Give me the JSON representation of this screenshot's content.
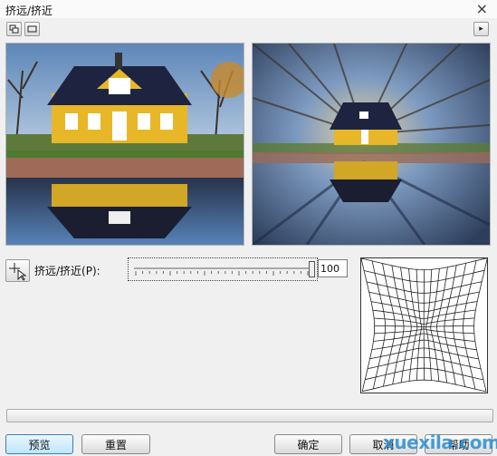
{
  "window": {
    "title": "挤远/挤近",
    "close_icon": "×"
  },
  "toolbar": {
    "left_icon_1": "dual-preview-icon",
    "left_icon_2": "single-preview-icon",
    "right_icon": "play-arrow-icon",
    "play_glyph": "▸"
  },
  "previews": [
    {
      "name": "original-preview",
      "content": "yellow house with pond reflection"
    },
    {
      "name": "result-preview",
      "content": "zoomed radial effect"
    }
  ],
  "control": {
    "label": "挤远/挤近(P):",
    "value": "100",
    "value_level": 100,
    "value_max": 100
  },
  "buttons": {
    "preview": "预览",
    "reset": "重置",
    "ok": "确定",
    "cancel": "取消",
    "help": "帮助"
  },
  "watermark": "xuexila.com",
  "colors": {
    "accent": "#3c7fb1",
    "house": "#e8b82a",
    "roof": "#1e2340",
    "water": "#4a7ab5"
  }
}
